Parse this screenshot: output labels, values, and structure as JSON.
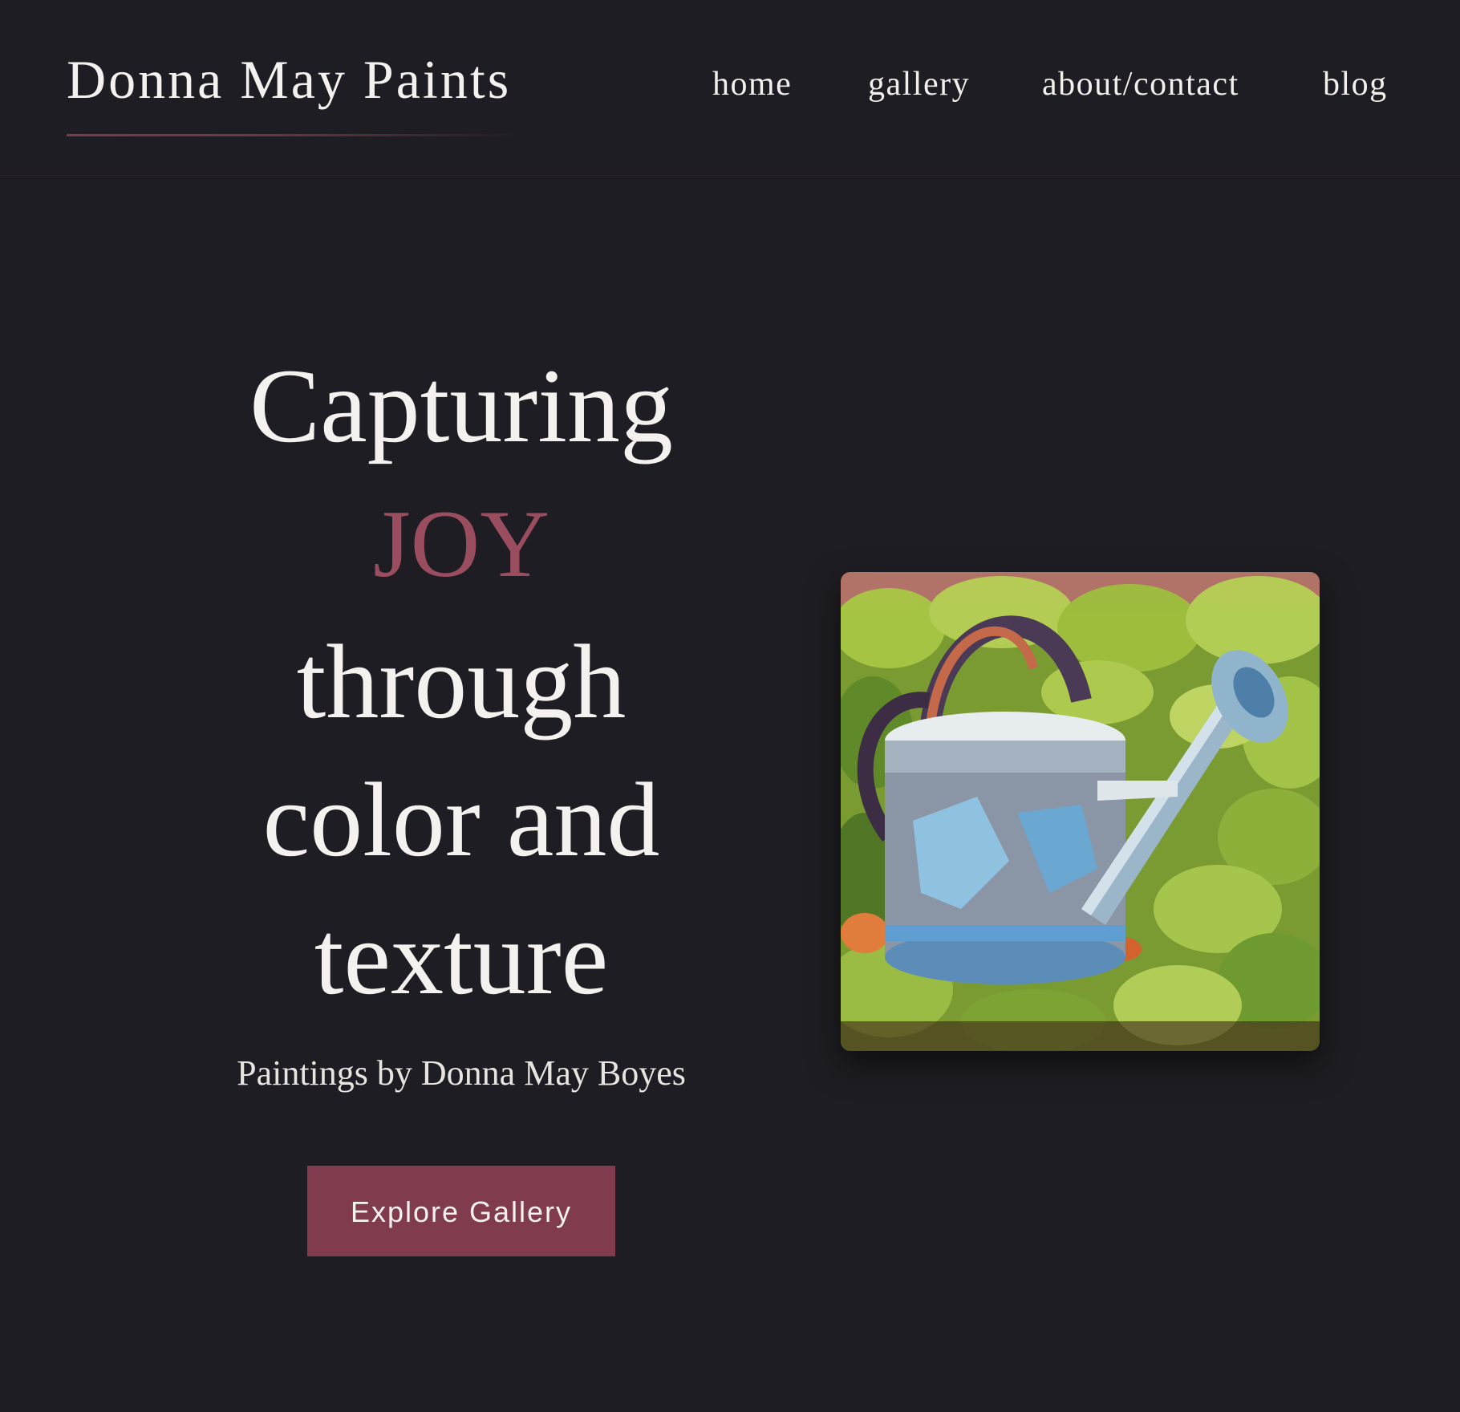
{
  "header": {
    "brand": "Donna May Paints",
    "nav": [
      {
        "label": "home"
      },
      {
        "label": "gallery"
      },
      {
        "label": "about/contact"
      },
      {
        "label": "blog"
      }
    ]
  },
  "hero": {
    "headline": {
      "line1": "Capturing",
      "accent": "JOY",
      "line3": "through",
      "line4": "color and",
      "line5": "texture"
    },
    "subtitle": "Paintings by Donna May Boyes",
    "cta_label": "Explore Gallery"
  },
  "painting": {
    "subject": "watering can among green leaves"
  },
  "colors": {
    "background": "#1e1d23",
    "accent": "#9a4d5f",
    "button": "#803b4d",
    "text": "#f4f1ee"
  }
}
